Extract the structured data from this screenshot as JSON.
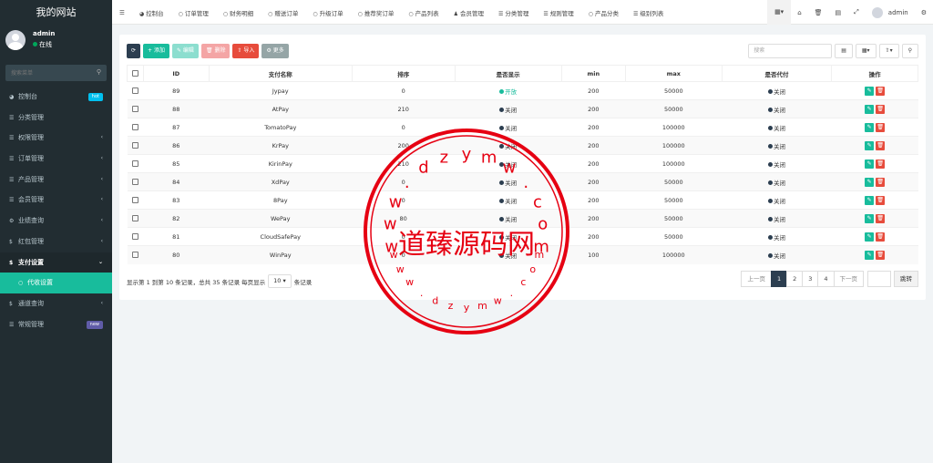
{
  "site_title": "我的网站",
  "user": {
    "name": "admin",
    "status": "在线"
  },
  "sidebar_search_placeholder": "搜索菜单",
  "menu": [
    {
      "label": "控制台",
      "icon": "dashboard-icon",
      "badge": "hot",
      "badge_color": "#00c0ef"
    },
    {
      "label": "分类管理",
      "icon": "list-icon"
    },
    {
      "label": "权限管理",
      "icon": "list-icon",
      "arrow": "‹"
    },
    {
      "label": "订单管理",
      "icon": "list-icon",
      "arrow": "‹"
    },
    {
      "label": "产品管理",
      "icon": "list-icon",
      "arrow": "‹"
    },
    {
      "label": "会员管理",
      "icon": "list-icon",
      "arrow": "‹"
    },
    {
      "label": "业绩查询",
      "icon": "gear-icon",
      "arrow": "‹"
    },
    {
      "label": "红包管理",
      "icon": "coin-icon",
      "arrow": "‹"
    },
    {
      "label": "支付设置",
      "icon": "coin-icon",
      "arrow": "⌄"
    },
    {
      "label": "代收设置",
      "icon": "circle-icon"
    },
    {
      "label": "通道查询",
      "icon": "coin-icon",
      "arrow": "‹"
    },
    {
      "label": "常规管理",
      "icon": "list-icon",
      "badge": "new",
      "badge_color": "#605ca8"
    }
  ],
  "top_nav": [
    {
      "label": "控制台",
      "icon": "dashboard-icon"
    },
    {
      "label": "订单管理",
      "icon": "circle-icon"
    },
    {
      "label": "财务明细",
      "icon": "circle-icon"
    },
    {
      "label": "赠送订单",
      "icon": "circle-icon"
    },
    {
      "label": "升级订单",
      "icon": "circle-icon"
    },
    {
      "label": "推荐奖订单",
      "icon": "circle-icon"
    },
    {
      "label": "产品列表",
      "icon": "circle-icon"
    },
    {
      "label": "会员管理",
      "icon": "user-icon"
    },
    {
      "label": "分类管理",
      "icon": "list-icon"
    },
    {
      "label": "规则管理",
      "icon": "list-icon"
    },
    {
      "label": "产品分类",
      "icon": "circle-icon"
    },
    {
      "label": "级别列表",
      "icon": "list-icon"
    }
  ],
  "top_user": "admin",
  "toolbar": {
    "add": "添加",
    "edit": "编辑",
    "delete": "删除",
    "import": "导入",
    "more": "更多"
  },
  "search_placeholder": "搜索",
  "columns": [
    "ID",
    "支付名称",
    "排序",
    "是否显示",
    "min",
    "max",
    "是否代付",
    "操作"
  ],
  "rows": [
    {
      "id": "89",
      "name": "Jypay",
      "sort": "0",
      "show": "开放",
      "show_on": true,
      "min": "200",
      "max": "50000",
      "daifu": "关闭"
    },
    {
      "id": "88",
      "name": "AtPay",
      "sort": "210",
      "show": "关闭",
      "show_on": false,
      "min": "200",
      "max": "50000",
      "daifu": "关闭"
    },
    {
      "id": "87",
      "name": "TomatoPay",
      "sort": "0",
      "show": "关闭",
      "show_on": false,
      "min": "200",
      "max": "100000",
      "daifu": "关闭"
    },
    {
      "id": "86",
      "name": "KrPay",
      "sort": "200",
      "show": "关闭",
      "show_on": false,
      "min": "200",
      "max": "100000",
      "daifu": "关闭"
    },
    {
      "id": "85",
      "name": "KirinPay",
      "sort": "210",
      "show": "关闭",
      "show_on": false,
      "min": "200",
      "max": "100000",
      "daifu": "关闭"
    },
    {
      "id": "84",
      "name": "XdPay",
      "sort": "0",
      "show": "关闭",
      "show_on": false,
      "min": "200",
      "max": "50000",
      "daifu": "关闭"
    },
    {
      "id": "83",
      "name": "8Pay",
      "sort": "0",
      "show": "关闭",
      "show_on": false,
      "min": "200",
      "max": "50000",
      "daifu": "关闭"
    },
    {
      "id": "82",
      "name": "WePay",
      "sort": "80",
      "show": "关闭",
      "show_on": false,
      "min": "200",
      "max": "50000",
      "daifu": "关闭"
    },
    {
      "id": "81",
      "name": "CloudSafePay",
      "sort": "0",
      "show": "关闭",
      "show_on": false,
      "min": "200",
      "max": "50000",
      "daifu": "关闭"
    },
    {
      "id": "80",
      "name": "WinPay",
      "sort": "0",
      "show": "关闭",
      "show_on": false,
      "min": "100",
      "max": "100000",
      "daifu": "关闭"
    }
  ],
  "pagination": {
    "info_prefix": "显示第 1 到第 10 条记录，总共 35 条记录 每页显示",
    "page_size": "10",
    "info_suffix": "条记录",
    "prev": "上一页",
    "pages": [
      "1",
      "2",
      "3",
      "4"
    ],
    "next": "下一页",
    "jump": "跳转"
  },
  "watermark": {
    "text": "道臻源码网",
    "url_top": "www.dzymw.com",
    "url_bottom": "www.dzymw.com"
  }
}
